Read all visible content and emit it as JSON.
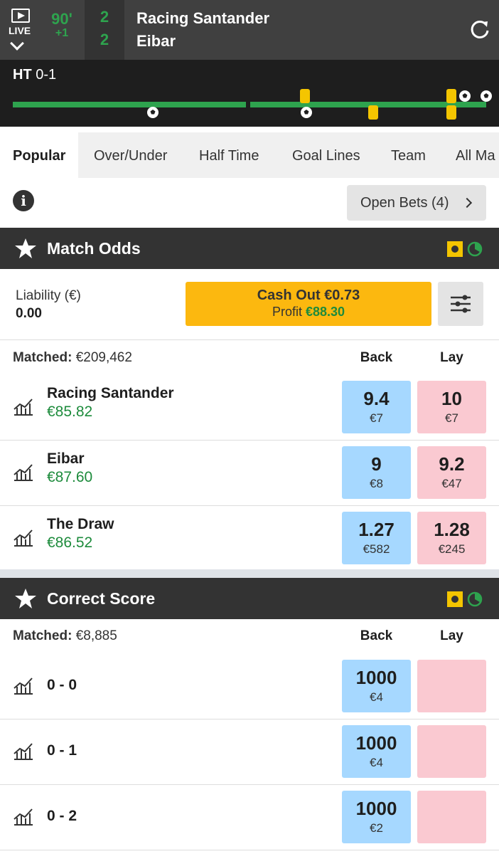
{
  "header": {
    "live_label": "LIVE",
    "clock_minute": "90'",
    "clock_added": "+1",
    "home_score": "2",
    "away_score": "2",
    "home_team": "Racing Santander",
    "away_team": "Eibar"
  },
  "timeline": {
    "ht_label": "HT",
    "ht_score": "0-1"
  },
  "tabs": [
    {
      "label": "Popular",
      "active": true
    },
    {
      "label": "Over/Under"
    },
    {
      "label": "Half Time"
    },
    {
      "label": "Goal Lines"
    },
    {
      "label": "Team"
    },
    {
      "label": "All Ma"
    }
  ],
  "open_bets_label": "Open Bets (4)",
  "match_odds": {
    "title": "Match Odds",
    "liability_label": "Liability (€)",
    "liability_value": "0.00",
    "cashout_label": "Cash Out €0.73",
    "profit_label": "Profit",
    "profit_value": "€88.30",
    "matched_label": "Matched:",
    "matched_value": "€209,462",
    "back_label": "Back",
    "lay_label": "Lay",
    "runners": [
      {
        "name": "Racing Santander",
        "pnl": "€85.82",
        "back_price": "9.4",
        "back_size": "€7",
        "lay_price": "10",
        "lay_size": "€7"
      },
      {
        "name": "Eibar",
        "pnl": "€87.60",
        "back_price": "9",
        "back_size": "€8",
        "lay_price": "9.2",
        "lay_size": "€47"
      },
      {
        "name": "The Draw",
        "pnl": "€86.52",
        "back_price": "1.27",
        "back_size": "€582",
        "lay_price": "1.28",
        "lay_size": "€245"
      }
    ]
  },
  "correct_score": {
    "title": "Correct Score",
    "matched_label": "Matched:",
    "matched_value": "€8,885",
    "back_label": "Back",
    "lay_label": "Lay",
    "runners": [
      {
        "name": "0 - 0",
        "back_price": "1000",
        "back_size": "€4"
      },
      {
        "name": "0 - 1",
        "back_price": "1000",
        "back_size": "€4"
      },
      {
        "name": "0 - 2",
        "back_price": "1000",
        "back_size": "€2"
      }
    ]
  },
  "colors": {
    "accent_green": "#2ea34e",
    "back_blue": "#a6d8ff",
    "lay_pink": "#fac9d1",
    "cashout_yellow": "#fcb80f",
    "header_dark": "#333333"
  }
}
